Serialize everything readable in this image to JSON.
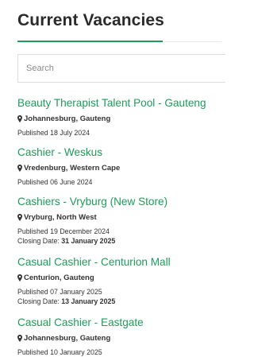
{
  "page": {
    "title": "Current Vacancies"
  },
  "search": {
    "placeholder": "Search",
    "value": ""
  },
  "icons": {
    "location": "map-marker-icon"
  },
  "colors": {
    "accent": "#1e9c5a",
    "heading": "#2b2b2b",
    "text": "#333333"
  },
  "jobs": [
    {
      "title": "Beauty Therapist Talent Pool - Gauteng",
      "location": "Johannesburg, Gauteng",
      "published_label": "Published",
      "published_date": "18 July 2024"
    },
    {
      "title": "Cashier - Weskus",
      "location": "Vredenburg, Western Cape",
      "published_label": "Published",
      "published_date": "06 June 2024"
    },
    {
      "title": "Cashiers - Vryburg (New Store)",
      "location": "Vryburg, North West",
      "published_label": "Published",
      "published_date": "19 December 2024",
      "closing_label": "Closing Date:",
      "closing_date": "31 January 2025"
    },
    {
      "title": "Casual Cashier - Centurion Mall",
      "location": "Centurion, Gauteng",
      "published_label": "Published",
      "published_date": "07 January 2025",
      "closing_label": "Closing Date:",
      "closing_date": "13 January 2025"
    },
    {
      "title": "Casual Cashier - Eastgate",
      "location": "Johannesburg, Gauteng",
      "published_label": "Published",
      "published_date": "10 January 2025"
    }
  ]
}
